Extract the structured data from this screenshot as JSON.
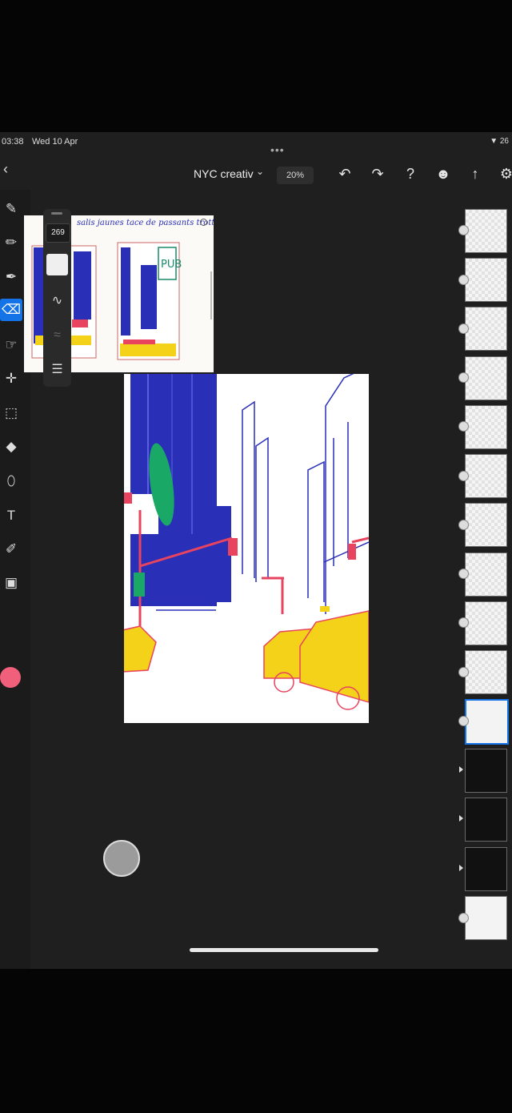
{
  "status": {
    "time": "03:38",
    "date": "Wed 10 Apr",
    "right": "▼ 26"
  },
  "header": {
    "back": "‹",
    "title": "NYC creativ",
    "title_chevron": "⌄",
    "zoom": "20%",
    "actions": [
      {
        "name": "undo-icon",
        "glyph": "↶"
      },
      {
        "name": "redo-icon",
        "glyph": "↷"
      },
      {
        "name": "help-icon",
        "glyph": "?"
      },
      {
        "name": "profile-icon",
        "glyph": "☻"
      },
      {
        "name": "share-icon",
        "glyph": "↑"
      },
      {
        "name": "settings-icon",
        "glyph": "⚙"
      }
    ]
  },
  "tools": [
    {
      "name": "pixel-brush-tool",
      "glyph": "✎"
    },
    {
      "name": "live-brush-tool",
      "glyph": "✏"
    },
    {
      "name": "vector-brush-tool",
      "glyph": "✒"
    },
    {
      "name": "eraser-tool",
      "glyph": "⌫",
      "active": true
    },
    {
      "name": "smudge-tool",
      "glyph": "☞"
    },
    {
      "name": "move-tool",
      "glyph": "✛"
    },
    {
      "name": "selection-tool",
      "glyph": "⬚"
    },
    {
      "name": "fill-tool",
      "glyph": "◆"
    },
    {
      "name": "shape-tool",
      "glyph": "⬯"
    },
    {
      "name": "text-tool",
      "glyph": "T"
    },
    {
      "name": "eyedropper-tool",
      "glyph": "✐"
    },
    {
      "name": "image-tool",
      "glyph": "▣"
    }
  ],
  "brush_panel": {
    "size": "269",
    "icons": [
      {
        "name": "stroke-smoothing-icon",
        "glyph": "∿"
      },
      {
        "name": "pressure-icon",
        "glyph": "≈"
      },
      {
        "name": "brush-settings-icon",
        "glyph": "☰"
      }
    ]
  },
  "reference_note": "salis jaunes tace de passants trottoirs",
  "colors": {
    "accent": "#1473e6",
    "current_color": "#f0607a",
    "ink_blue": "#2a2fb8",
    "taxi_yellow": "#f5d21a",
    "signal_red": "#e8435f",
    "green": "#1aa866"
  },
  "layers": [
    {
      "type": "checker"
    },
    {
      "type": "checker"
    },
    {
      "type": "checker"
    },
    {
      "type": "checker"
    },
    {
      "type": "checker"
    },
    {
      "type": "checker"
    },
    {
      "type": "checker"
    },
    {
      "type": "checker"
    },
    {
      "type": "checker"
    },
    {
      "type": "checker"
    },
    {
      "type": "selected"
    },
    {
      "type": "dark"
    },
    {
      "type": "dark"
    },
    {
      "type": "dark"
    },
    {
      "type": "plain"
    }
  ]
}
